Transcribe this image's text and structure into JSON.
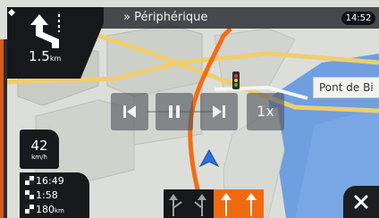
{
  "header": {
    "street_prefix": "»",
    "street_name": "Périphérique",
    "clock": "14:52"
  },
  "next_turn": {
    "distance_value": "1.5",
    "distance_unit": "km",
    "icon": "keep-left-arrow-icon"
  },
  "speed": {
    "value": "42",
    "unit": "km/h"
  },
  "trip": {
    "arrival_time": "16:49",
    "time_remaining": "1:58",
    "distance_remaining_value": "180",
    "distance_remaining_unit": "km"
  },
  "media_controls": {
    "previous": "skip-back-icon",
    "pause": "pause-icon",
    "next": "skip-forward-icon",
    "speed_label": "1x"
  },
  "map": {
    "poi_label": "Pont de Bi",
    "water_color": "#6f9fe0",
    "route_color": "#f36d14",
    "road_color": "#f0cd6e"
  },
  "lanes": [
    {
      "icon": "lane-straight-left-icon",
      "active": false
    },
    {
      "icon": "lane-straight-left-icon",
      "active": false
    },
    {
      "icon": "lane-straight-icon",
      "active": true
    },
    {
      "icon": "lane-straight-icon",
      "active": true
    }
  ],
  "close_button": "close-icon",
  "colors": {
    "accent": "#f06a10",
    "panel": "#17191d"
  }
}
